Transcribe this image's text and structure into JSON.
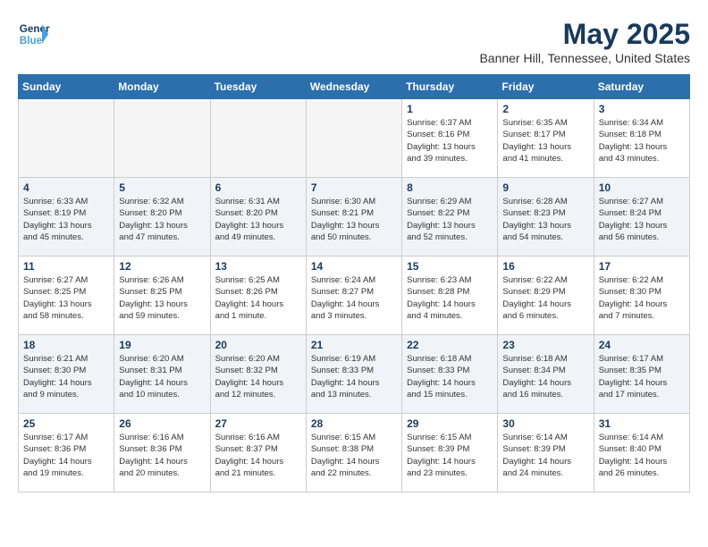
{
  "header": {
    "logo_line1": "General",
    "logo_line2": "Blue",
    "month": "May 2025",
    "location": "Banner Hill, Tennessee, United States"
  },
  "weekdays": [
    "Sunday",
    "Monday",
    "Tuesday",
    "Wednesday",
    "Thursday",
    "Friday",
    "Saturday"
  ],
  "weeks": [
    [
      {
        "day": "",
        "info": ""
      },
      {
        "day": "",
        "info": ""
      },
      {
        "day": "",
        "info": ""
      },
      {
        "day": "",
        "info": ""
      },
      {
        "day": "1",
        "info": "Sunrise: 6:37 AM\nSunset: 8:16 PM\nDaylight: 13 hours\nand 39 minutes."
      },
      {
        "day": "2",
        "info": "Sunrise: 6:35 AM\nSunset: 8:17 PM\nDaylight: 13 hours\nand 41 minutes."
      },
      {
        "day": "3",
        "info": "Sunrise: 6:34 AM\nSunset: 8:18 PM\nDaylight: 13 hours\nand 43 minutes."
      }
    ],
    [
      {
        "day": "4",
        "info": "Sunrise: 6:33 AM\nSunset: 8:19 PM\nDaylight: 13 hours\nand 45 minutes."
      },
      {
        "day": "5",
        "info": "Sunrise: 6:32 AM\nSunset: 8:20 PM\nDaylight: 13 hours\nand 47 minutes."
      },
      {
        "day": "6",
        "info": "Sunrise: 6:31 AM\nSunset: 8:20 PM\nDaylight: 13 hours\nand 49 minutes."
      },
      {
        "day": "7",
        "info": "Sunrise: 6:30 AM\nSunset: 8:21 PM\nDaylight: 13 hours\nand 50 minutes."
      },
      {
        "day": "8",
        "info": "Sunrise: 6:29 AM\nSunset: 8:22 PM\nDaylight: 13 hours\nand 52 minutes."
      },
      {
        "day": "9",
        "info": "Sunrise: 6:28 AM\nSunset: 8:23 PM\nDaylight: 13 hours\nand 54 minutes."
      },
      {
        "day": "10",
        "info": "Sunrise: 6:27 AM\nSunset: 8:24 PM\nDaylight: 13 hours\nand 56 minutes."
      }
    ],
    [
      {
        "day": "11",
        "info": "Sunrise: 6:27 AM\nSunset: 8:25 PM\nDaylight: 13 hours\nand 58 minutes."
      },
      {
        "day": "12",
        "info": "Sunrise: 6:26 AM\nSunset: 8:25 PM\nDaylight: 13 hours\nand 59 minutes."
      },
      {
        "day": "13",
        "info": "Sunrise: 6:25 AM\nSunset: 8:26 PM\nDaylight: 14 hours\nand 1 minute."
      },
      {
        "day": "14",
        "info": "Sunrise: 6:24 AM\nSunset: 8:27 PM\nDaylight: 14 hours\nand 3 minutes."
      },
      {
        "day": "15",
        "info": "Sunrise: 6:23 AM\nSunset: 8:28 PM\nDaylight: 14 hours\nand 4 minutes."
      },
      {
        "day": "16",
        "info": "Sunrise: 6:22 AM\nSunset: 8:29 PM\nDaylight: 14 hours\nand 6 minutes."
      },
      {
        "day": "17",
        "info": "Sunrise: 6:22 AM\nSunset: 8:30 PM\nDaylight: 14 hours\nand 7 minutes."
      }
    ],
    [
      {
        "day": "18",
        "info": "Sunrise: 6:21 AM\nSunset: 8:30 PM\nDaylight: 14 hours\nand 9 minutes."
      },
      {
        "day": "19",
        "info": "Sunrise: 6:20 AM\nSunset: 8:31 PM\nDaylight: 14 hours\nand 10 minutes."
      },
      {
        "day": "20",
        "info": "Sunrise: 6:20 AM\nSunset: 8:32 PM\nDaylight: 14 hours\nand 12 minutes."
      },
      {
        "day": "21",
        "info": "Sunrise: 6:19 AM\nSunset: 8:33 PM\nDaylight: 14 hours\nand 13 minutes."
      },
      {
        "day": "22",
        "info": "Sunrise: 6:18 AM\nSunset: 8:33 PM\nDaylight: 14 hours\nand 15 minutes."
      },
      {
        "day": "23",
        "info": "Sunrise: 6:18 AM\nSunset: 8:34 PM\nDaylight: 14 hours\nand 16 minutes."
      },
      {
        "day": "24",
        "info": "Sunrise: 6:17 AM\nSunset: 8:35 PM\nDaylight: 14 hours\nand 17 minutes."
      }
    ],
    [
      {
        "day": "25",
        "info": "Sunrise: 6:17 AM\nSunset: 8:36 PM\nDaylight: 14 hours\nand 19 minutes."
      },
      {
        "day": "26",
        "info": "Sunrise: 6:16 AM\nSunset: 8:36 PM\nDaylight: 14 hours\nand 20 minutes."
      },
      {
        "day": "27",
        "info": "Sunrise: 6:16 AM\nSunset: 8:37 PM\nDaylight: 14 hours\nand 21 minutes."
      },
      {
        "day": "28",
        "info": "Sunrise: 6:15 AM\nSunset: 8:38 PM\nDaylight: 14 hours\nand 22 minutes."
      },
      {
        "day": "29",
        "info": "Sunrise: 6:15 AM\nSunset: 8:39 PM\nDaylight: 14 hours\nand 23 minutes."
      },
      {
        "day": "30",
        "info": "Sunrise: 6:14 AM\nSunset: 8:39 PM\nDaylight: 14 hours\nand 24 minutes."
      },
      {
        "day": "31",
        "info": "Sunrise: 6:14 AM\nSunset: 8:40 PM\nDaylight: 14 hours\nand 26 minutes."
      }
    ]
  ]
}
